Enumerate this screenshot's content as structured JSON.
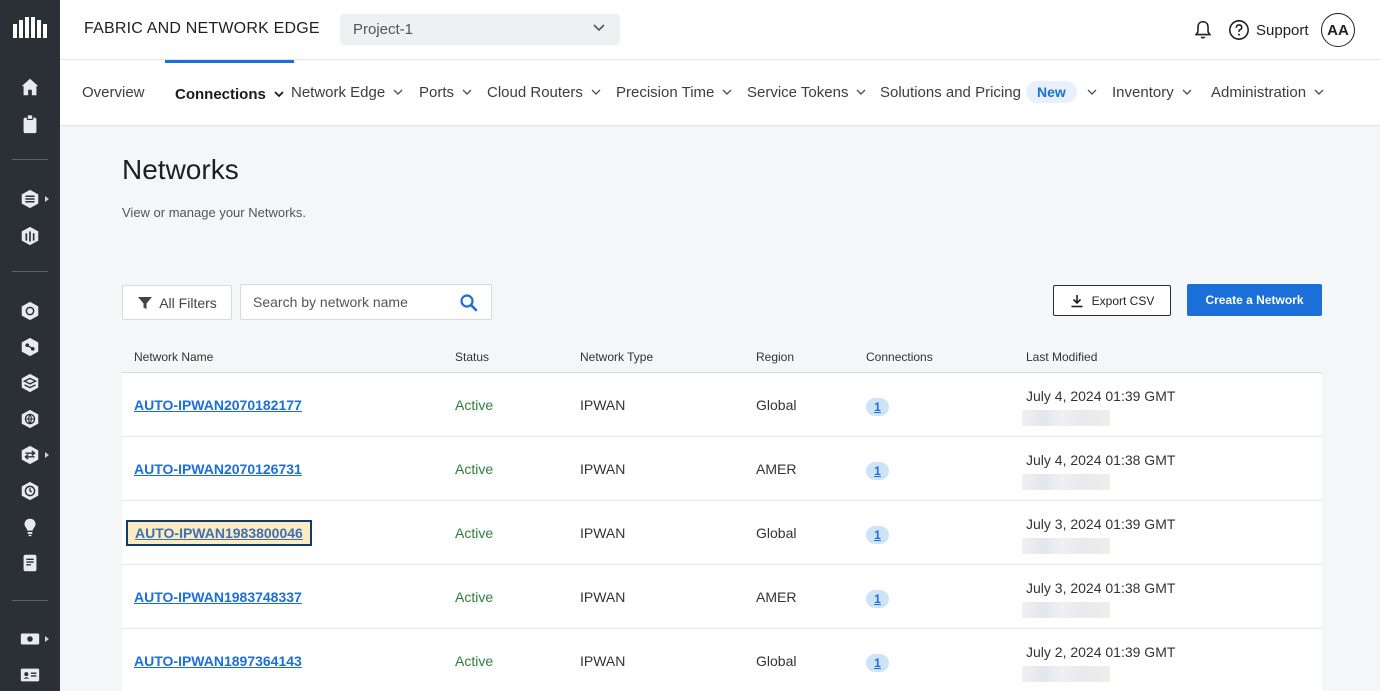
{
  "header": {
    "app_title": "FABRIC AND NETWORK EDGE",
    "project": "Project-1",
    "support_label": "Support",
    "avatar_initials": "AA"
  },
  "nav": {
    "items": [
      {
        "label": "Overview",
        "has_menu": false,
        "active": false
      },
      {
        "label": "Connections",
        "has_menu": true,
        "active": true
      },
      {
        "label": "Network Edge",
        "has_menu": true,
        "active": false
      },
      {
        "label": "Ports",
        "has_menu": true,
        "active": false
      },
      {
        "label": "Cloud Routers",
        "has_menu": true,
        "active": false
      },
      {
        "label": "Precision Time",
        "has_menu": true,
        "active": false
      },
      {
        "label": "Service Tokens",
        "has_menu": true,
        "active": false
      },
      {
        "label": "Solutions and Pricing",
        "has_menu": false,
        "active": false
      },
      {
        "label": "Inventory",
        "has_menu": true,
        "active": false
      },
      {
        "label": "Administration",
        "has_menu": true,
        "active": false
      }
    ],
    "new_badge": "New"
  },
  "page": {
    "title": "Networks",
    "subtitle": "View or manage your Networks."
  },
  "toolbar": {
    "filters_label": "All Filters",
    "search_placeholder": "Search by network name",
    "export_label": "Export CSV",
    "create_label": "Create a Network"
  },
  "table": {
    "columns": [
      "Network Name",
      "Status",
      "Network Type",
      "Region",
      "Connections",
      "Last Modified"
    ],
    "rows": [
      {
        "name": "AUTO-IPWAN2070182177",
        "status": "Active",
        "type": "IPWAN",
        "region": "Global",
        "connections": "1",
        "modified": "July 4, 2024 01:39 GMT",
        "focused": false
      },
      {
        "name": "AUTO-IPWAN2070126731",
        "status": "Active",
        "type": "IPWAN",
        "region": "AMER",
        "connections": "1",
        "modified": "July 4, 2024 01:38 GMT",
        "focused": false
      },
      {
        "name": "AUTO-IPWAN1983800046",
        "status": "Active",
        "type": "IPWAN",
        "region": "Global",
        "connections": "1",
        "modified": "July 3, 2024 01:39 GMT",
        "focused": true
      },
      {
        "name": "AUTO-IPWAN1983748337",
        "status": "Active",
        "type": "IPWAN",
        "region": "AMER",
        "connections": "1",
        "modified": "July 3, 2024 01:38 GMT",
        "focused": false
      },
      {
        "name": "AUTO-IPWAN1897364143",
        "status": "Active",
        "type": "IPWAN",
        "region": "Global",
        "connections": "1",
        "modified": "July 2, 2024 01:39 GMT",
        "focused": false
      }
    ]
  },
  "sidebar": {
    "icons": [
      "equinix-logo-icon",
      "home-icon",
      "clipboard-icon",
      "layers-icon",
      "metal-icon",
      "fabric-icon",
      "network-edge-icon",
      "stack-icon",
      "globe-icon",
      "exchange-icon",
      "clock-icon",
      "lightbulb-icon",
      "book-icon",
      "billing-icon",
      "contact-card-icon"
    ]
  },
  "colors": {
    "accent": "#1b6fd9",
    "status_active": "#2f7d3b",
    "rail": "#2b3036",
    "focus_highlight": "#fbecc4"
  }
}
